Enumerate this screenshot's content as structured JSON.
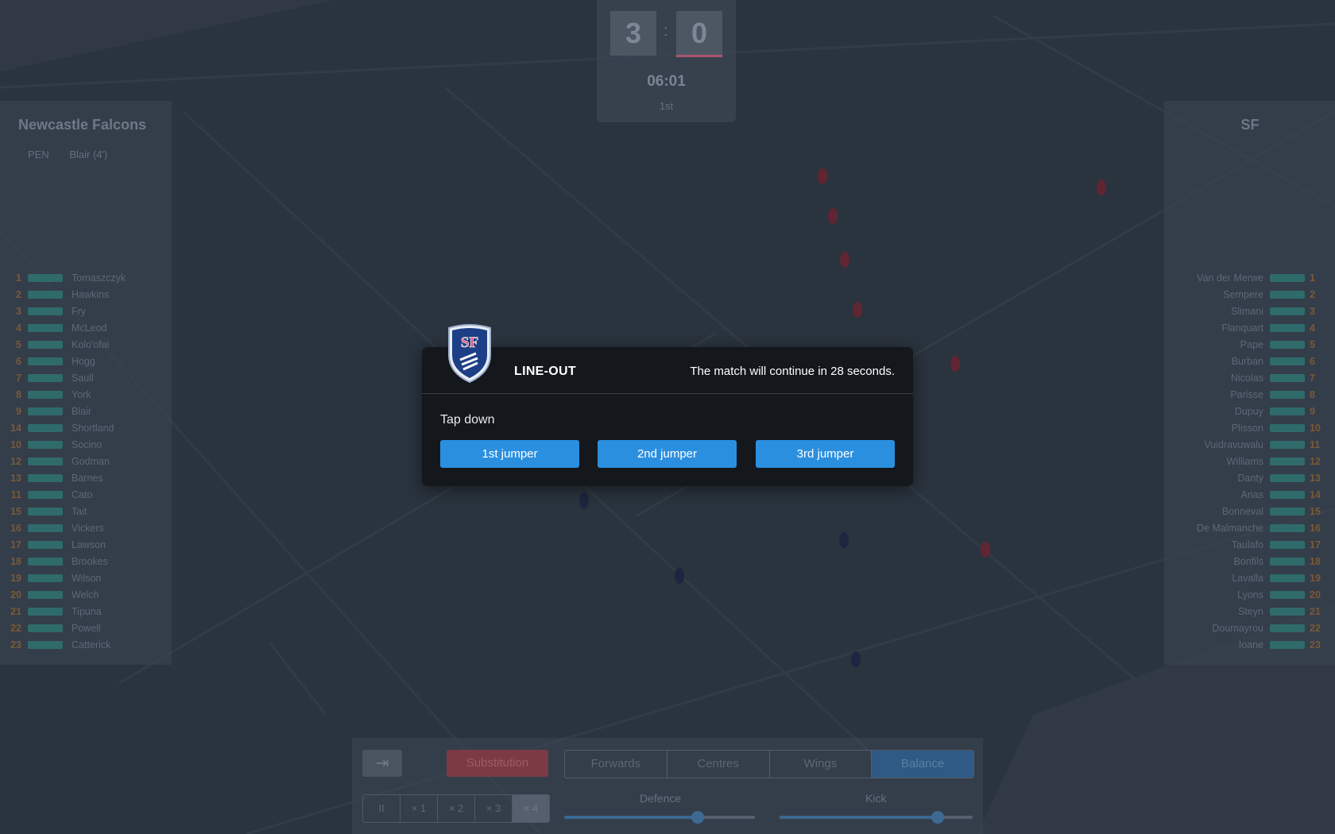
{
  "scoreboard": {
    "home_score": "3",
    "away_score": "0",
    "separator": ":",
    "clock": "06:01",
    "period": "1st"
  },
  "home_team": {
    "name": "Newcastle Falcons",
    "events": [
      {
        "type": "PEN",
        "player": "Blair (4')"
      }
    ],
    "players": [
      {
        "num": "1",
        "name": "Tomaszczyk"
      },
      {
        "num": "2",
        "name": "Hawkins"
      },
      {
        "num": "3",
        "name": "Fry"
      },
      {
        "num": "4",
        "name": "McLeod"
      },
      {
        "num": "5",
        "name": "Kolo'ofai"
      },
      {
        "num": "6",
        "name": "Hogg"
      },
      {
        "num": "7",
        "name": "Saull"
      },
      {
        "num": "8",
        "name": "York"
      },
      {
        "num": "9",
        "name": "Blair"
      },
      {
        "num": "14",
        "name": "Shortland"
      },
      {
        "num": "10",
        "name": "Socino"
      },
      {
        "num": "12",
        "name": "Godman"
      },
      {
        "num": "13",
        "name": "Barnes"
      },
      {
        "num": "11",
        "name": "Cato"
      },
      {
        "num": "15",
        "name": "Tait"
      },
      {
        "num": "16",
        "name": "Vickers"
      },
      {
        "num": "17",
        "name": "Lawson"
      },
      {
        "num": "18",
        "name": "Brookes"
      },
      {
        "num": "19",
        "name": "Wilson"
      },
      {
        "num": "20",
        "name": "Welch"
      },
      {
        "num": "21",
        "name": "Tipuna"
      },
      {
        "num": "22",
        "name": "Powell"
      },
      {
        "num": "23",
        "name": "Catterick"
      }
    ]
  },
  "away_team": {
    "name": "SF",
    "players": [
      {
        "num": "1",
        "name": "Van der Merwe"
      },
      {
        "num": "2",
        "name": "Sempere"
      },
      {
        "num": "3",
        "name": "Slimani"
      },
      {
        "num": "4",
        "name": "Flanquart"
      },
      {
        "num": "5",
        "name": "Pape"
      },
      {
        "num": "6",
        "name": "Burban"
      },
      {
        "num": "7",
        "name": "Nicolas"
      },
      {
        "num": "8",
        "name": "Parisse"
      },
      {
        "num": "9",
        "name": "Dupuy"
      },
      {
        "num": "10",
        "name": "Plisson"
      },
      {
        "num": "11",
        "name": "Vuidravuwalu"
      },
      {
        "num": "12",
        "name": "Williams"
      },
      {
        "num": "13",
        "name": "Danty"
      },
      {
        "num": "14",
        "name": "Arias"
      },
      {
        "num": "15",
        "name": "Bonneval"
      },
      {
        "num": "16",
        "name": "De Malmanche"
      },
      {
        "num": "17",
        "name": "Taulafo"
      },
      {
        "num": "18",
        "name": "Bonfils"
      },
      {
        "num": "19",
        "name": "Lavalla"
      },
      {
        "num": "20",
        "name": "Lyons"
      },
      {
        "num": "21",
        "name": "Steyn"
      },
      {
        "num": "22",
        "name": "Doumayrou"
      },
      {
        "num": "23",
        "name": "Ioane"
      }
    ]
  },
  "controls": {
    "exit_icon": "exit-icon",
    "substitution_label": "Substitution",
    "tactic_tabs": [
      {
        "label": "Forwards",
        "active": false
      },
      {
        "label": "Centres",
        "active": false
      },
      {
        "label": "Wings",
        "active": false
      },
      {
        "label": "Balance",
        "active": true
      }
    ],
    "speed_buttons": [
      {
        "label": "II",
        "active": false
      },
      {
        "label": "× 1",
        "active": false
      },
      {
        "label": "× 2",
        "active": false
      },
      {
        "label": "× 3",
        "active": false
      },
      {
        "label": "× 4",
        "active": true
      }
    ],
    "defence_label": "Defence",
    "defence_level": 0.7,
    "kick_label": "Kick",
    "kick_level": 0.82
  },
  "modal": {
    "crest_text": "SF",
    "title": "LINE-OUT",
    "message": "The match will continue in 28 seconds.",
    "prompt": "Tap down",
    "options": [
      "1st jumper",
      "2nd jumper",
      "3rd jumper"
    ]
  },
  "colors": {
    "home_kit": "#1f2a5a",
    "away_kit": "#b5283a",
    "button_blue": "#2b8fe0",
    "pitch": "#3a4652"
  }
}
